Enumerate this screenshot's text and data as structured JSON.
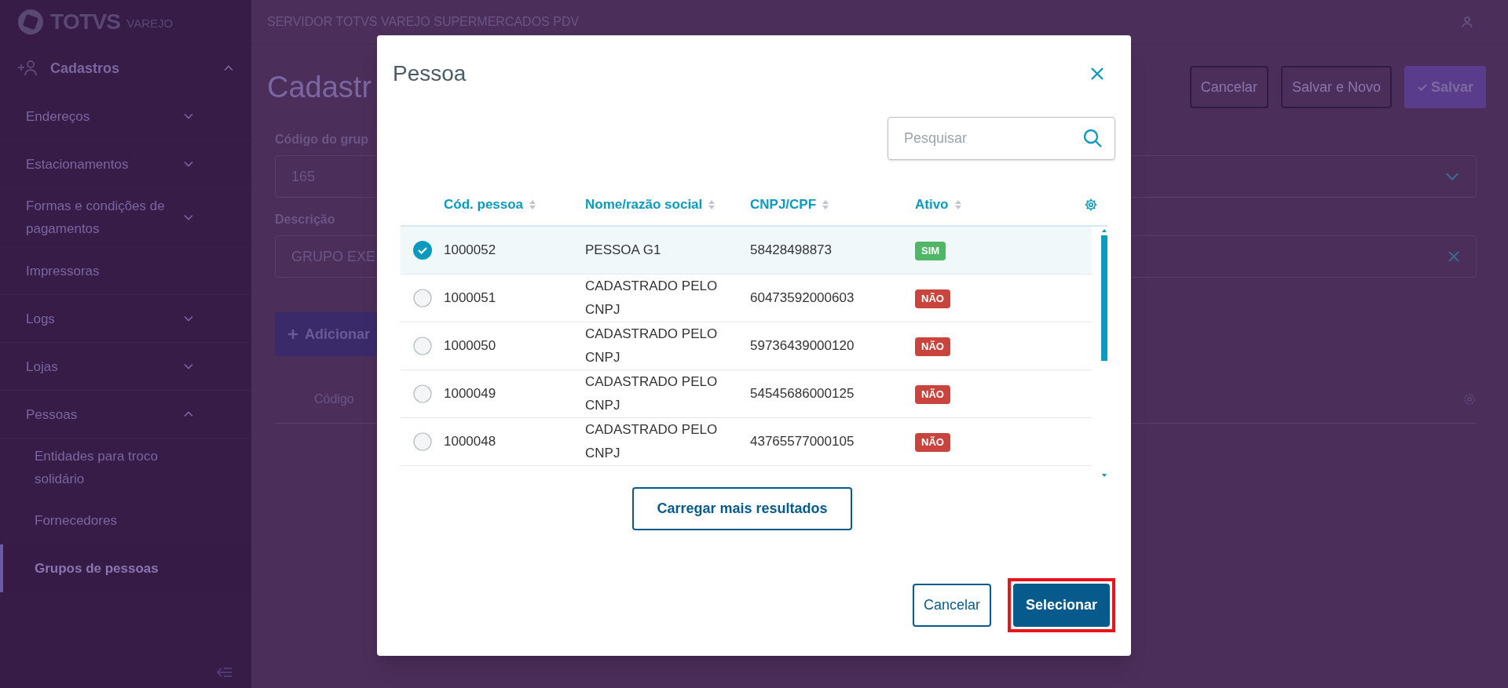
{
  "sidebar": {
    "logo": {
      "brand": "TOTVS",
      "product": "VAREJO"
    },
    "menu": {
      "label": "Cadastros",
      "expanded": true,
      "children": [
        {
          "label": "Endereços",
          "kind": "group",
          "expanded": false
        },
        {
          "label": "Estacionamentos",
          "kind": "group",
          "expanded": false
        },
        {
          "label": "Formas e condições de pagamentos",
          "kind": "group",
          "expanded": false
        },
        {
          "label": "Impressoras",
          "kind": "link",
          "selected": false
        },
        {
          "label": "Logs",
          "kind": "group",
          "expanded": false
        },
        {
          "label": "Lojas",
          "kind": "group",
          "expanded": false
        },
        {
          "label": "Pessoas",
          "kind": "group",
          "expanded": true,
          "children": [
            {
              "label": "Entidades para troco solidário",
              "selected": false
            },
            {
              "label": "Fornecedores",
              "selected": false
            },
            {
              "label": "Grupos de pessoas",
              "selected": true
            }
          ]
        }
      ]
    }
  },
  "header": {
    "title": "SERVIDOR TOTVS VAREJO SUPERMERCADOS PDV"
  },
  "page": {
    "title": "Cadastr",
    "actions": [
      {
        "label": "Cancelar",
        "kind": "outline"
      },
      {
        "label": "Salvar e Novo",
        "kind": "outline"
      },
      {
        "label": "Salvar",
        "kind": "primary"
      }
    ],
    "fields": [
      {
        "label": "Código do grup",
        "value": "165",
        "kind": "select"
      },
      {
        "label": "Descrição",
        "value": "GRUPO EXE",
        "kind": "clearable"
      }
    ],
    "add_button": "Adicionar",
    "table": {
      "columns": [
        "Código"
      ]
    }
  },
  "modal": {
    "title": "Pessoa",
    "search": {
      "placeholder": "Pesquisar"
    },
    "table": {
      "columns": [
        "Cód. pessoa",
        "Nome/razão social",
        "CNPJ/CPF",
        "Ativo"
      ],
      "rows": [
        {
          "code": "1000052",
          "name": "PESSOA G1",
          "document": "58428498873",
          "active": {
            "text": "SIM",
            "kind": "yes"
          },
          "selected": true
        },
        {
          "code": "1000051",
          "name": "CADASTRADO PELO CNPJ",
          "document": "60473592000603",
          "active": {
            "text": "NÃO",
            "kind": "no"
          },
          "selected": false
        },
        {
          "code": "1000050",
          "name": "CADASTRADO PELO CNPJ",
          "document": "59736439000120",
          "active": {
            "text": "NÃO",
            "kind": "no"
          },
          "selected": false
        },
        {
          "code": "1000049",
          "name": "CADASTRADO PELO CNPJ",
          "document": "54545686000125",
          "active": {
            "text": "NÃO",
            "kind": "no"
          },
          "selected": false
        },
        {
          "code": "1000048",
          "name": "CADASTRADO PELO CNPJ",
          "document": "43765577000105",
          "active": {
            "text": "NÃO",
            "kind": "no"
          },
          "selected": false
        }
      ]
    },
    "load_more": "Carregar mais resultados",
    "buttons": [
      {
        "label": "Cancelar",
        "kind": "outline",
        "highlighted": false
      },
      {
        "label": "Selecionar",
        "kind": "primary",
        "highlighted": true
      }
    ]
  }
}
